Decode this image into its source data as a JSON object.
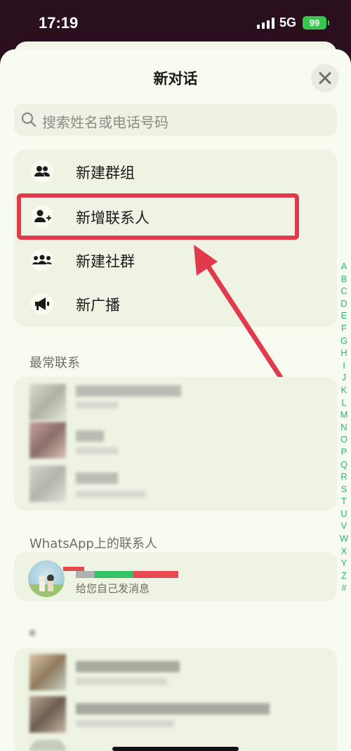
{
  "status_bar": {
    "time": "17:19",
    "network": "5G",
    "battery": "99"
  },
  "header": {
    "title": "新对话"
  },
  "search": {
    "placeholder": "搜索姓名或电话号码"
  },
  "actions": [
    {
      "label": "新建群组",
      "icon": "group-icon"
    },
    {
      "label": "新增联系人",
      "icon": "add-contact-icon"
    },
    {
      "label": "新建社群",
      "icon": "community-icon"
    },
    {
      "label": "新广播",
      "icon": "broadcast-icon"
    }
  ],
  "sections": {
    "frequent": "最常联系",
    "whatsapp_contacts": "WhatsApp上的联系人"
  },
  "self_contact": {
    "subtitle": "给您自己发消息"
  },
  "alphabet_index": [
    "A",
    "B",
    "C",
    "D",
    "E",
    "F",
    "G",
    "H",
    "I",
    "J",
    "K",
    "L",
    "M",
    "N",
    "O",
    "P",
    "Q",
    "R",
    "S",
    "T",
    "U",
    "V",
    "W",
    "X",
    "Y",
    "Z",
    "#"
  ],
  "colors": {
    "accent": "#2bb673",
    "highlight": "#e23a4c",
    "sheet_bg": "#f8fcf0"
  }
}
